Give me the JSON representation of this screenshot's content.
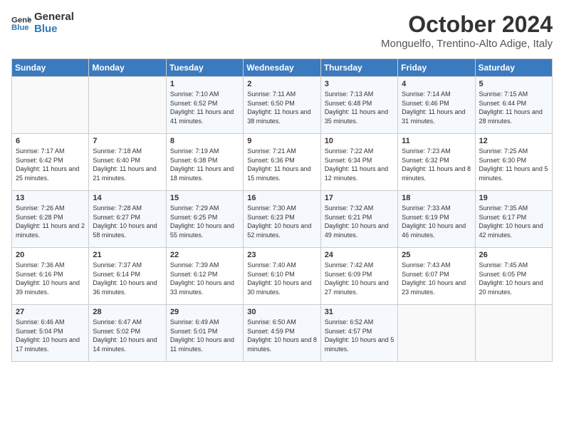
{
  "header": {
    "logo_line1": "General",
    "logo_line2": "Blue",
    "month": "October 2024",
    "location": "Monguelfo, Trentino-Alto Adige, Italy"
  },
  "weekdays": [
    "Sunday",
    "Monday",
    "Tuesday",
    "Wednesday",
    "Thursday",
    "Friday",
    "Saturday"
  ],
  "weeks": [
    [
      {
        "day": "",
        "sunrise": "",
        "sunset": "",
        "daylight": ""
      },
      {
        "day": "",
        "sunrise": "",
        "sunset": "",
        "daylight": ""
      },
      {
        "day": "1",
        "sunrise": "Sunrise: 7:10 AM",
        "sunset": "Sunset: 6:52 PM",
        "daylight": "Daylight: 11 hours and 41 minutes."
      },
      {
        "day": "2",
        "sunrise": "Sunrise: 7:11 AM",
        "sunset": "Sunset: 6:50 PM",
        "daylight": "Daylight: 11 hours and 38 minutes."
      },
      {
        "day": "3",
        "sunrise": "Sunrise: 7:13 AM",
        "sunset": "Sunset: 6:48 PM",
        "daylight": "Daylight: 11 hours and 35 minutes."
      },
      {
        "day": "4",
        "sunrise": "Sunrise: 7:14 AM",
        "sunset": "Sunset: 6:46 PM",
        "daylight": "Daylight: 11 hours and 31 minutes."
      },
      {
        "day": "5",
        "sunrise": "Sunrise: 7:15 AM",
        "sunset": "Sunset: 6:44 PM",
        "daylight": "Daylight: 11 hours and 28 minutes."
      }
    ],
    [
      {
        "day": "6",
        "sunrise": "Sunrise: 7:17 AM",
        "sunset": "Sunset: 6:42 PM",
        "daylight": "Daylight: 11 hours and 25 minutes."
      },
      {
        "day": "7",
        "sunrise": "Sunrise: 7:18 AM",
        "sunset": "Sunset: 6:40 PM",
        "daylight": "Daylight: 11 hours and 21 minutes."
      },
      {
        "day": "8",
        "sunrise": "Sunrise: 7:19 AM",
        "sunset": "Sunset: 6:38 PM",
        "daylight": "Daylight: 11 hours and 18 minutes."
      },
      {
        "day": "9",
        "sunrise": "Sunrise: 7:21 AM",
        "sunset": "Sunset: 6:36 PM",
        "daylight": "Daylight: 11 hours and 15 minutes."
      },
      {
        "day": "10",
        "sunrise": "Sunrise: 7:22 AM",
        "sunset": "Sunset: 6:34 PM",
        "daylight": "Daylight: 11 hours and 12 minutes."
      },
      {
        "day": "11",
        "sunrise": "Sunrise: 7:23 AM",
        "sunset": "Sunset: 6:32 PM",
        "daylight": "Daylight: 11 hours and 8 minutes."
      },
      {
        "day": "12",
        "sunrise": "Sunrise: 7:25 AM",
        "sunset": "Sunset: 6:30 PM",
        "daylight": "Daylight: 11 hours and 5 minutes."
      }
    ],
    [
      {
        "day": "13",
        "sunrise": "Sunrise: 7:26 AM",
        "sunset": "Sunset: 6:28 PM",
        "daylight": "Daylight: 11 hours and 2 minutes."
      },
      {
        "day": "14",
        "sunrise": "Sunrise: 7:28 AM",
        "sunset": "Sunset: 6:27 PM",
        "daylight": "Daylight: 10 hours and 58 minutes."
      },
      {
        "day": "15",
        "sunrise": "Sunrise: 7:29 AM",
        "sunset": "Sunset: 6:25 PM",
        "daylight": "Daylight: 10 hours and 55 minutes."
      },
      {
        "day": "16",
        "sunrise": "Sunrise: 7:30 AM",
        "sunset": "Sunset: 6:23 PM",
        "daylight": "Daylight: 10 hours and 52 minutes."
      },
      {
        "day": "17",
        "sunrise": "Sunrise: 7:32 AM",
        "sunset": "Sunset: 6:21 PM",
        "daylight": "Daylight: 10 hours and 49 minutes."
      },
      {
        "day": "18",
        "sunrise": "Sunrise: 7:33 AM",
        "sunset": "Sunset: 6:19 PM",
        "daylight": "Daylight: 10 hours and 46 minutes."
      },
      {
        "day": "19",
        "sunrise": "Sunrise: 7:35 AM",
        "sunset": "Sunset: 6:17 PM",
        "daylight": "Daylight: 10 hours and 42 minutes."
      }
    ],
    [
      {
        "day": "20",
        "sunrise": "Sunrise: 7:36 AM",
        "sunset": "Sunset: 6:16 PM",
        "daylight": "Daylight: 10 hours and 39 minutes."
      },
      {
        "day": "21",
        "sunrise": "Sunrise: 7:37 AM",
        "sunset": "Sunset: 6:14 PM",
        "daylight": "Daylight: 10 hours and 36 minutes."
      },
      {
        "day": "22",
        "sunrise": "Sunrise: 7:39 AM",
        "sunset": "Sunset: 6:12 PM",
        "daylight": "Daylight: 10 hours and 33 minutes."
      },
      {
        "day": "23",
        "sunrise": "Sunrise: 7:40 AM",
        "sunset": "Sunset: 6:10 PM",
        "daylight": "Daylight: 10 hours and 30 minutes."
      },
      {
        "day": "24",
        "sunrise": "Sunrise: 7:42 AM",
        "sunset": "Sunset: 6:09 PM",
        "daylight": "Daylight: 10 hours and 27 minutes."
      },
      {
        "day": "25",
        "sunrise": "Sunrise: 7:43 AM",
        "sunset": "Sunset: 6:07 PM",
        "daylight": "Daylight: 10 hours and 23 minutes."
      },
      {
        "day": "26",
        "sunrise": "Sunrise: 7:45 AM",
        "sunset": "Sunset: 6:05 PM",
        "daylight": "Daylight: 10 hours and 20 minutes."
      }
    ],
    [
      {
        "day": "27",
        "sunrise": "Sunrise: 6:46 AM",
        "sunset": "Sunset: 5:04 PM",
        "daylight": "Daylight: 10 hours and 17 minutes."
      },
      {
        "day": "28",
        "sunrise": "Sunrise: 6:47 AM",
        "sunset": "Sunset: 5:02 PM",
        "daylight": "Daylight: 10 hours and 14 minutes."
      },
      {
        "day": "29",
        "sunrise": "Sunrise: 6:49 AM",
        "sunset": "Sunset: 5:01 PM",
        "daylight": "Daylight: 10 hours and 11 minutes."
      },
      {
        "day": "30",
        "sunrise": "Sunrise: 6:50 AM",
        "sunset": "Sunset: 4:59 PM",
        "daylight": "Daylight: 10 hours and 8 minutes."
      },
      {
        "day": "31",
        "sunrise": "Sunrise: 6:52 AM",
        "sunset": "Sunset: 4:57 PM",
        "daylight": "Daylight: 10 hours and 5 minutes."
      },
      {
        "day": "",
        "sunrise": "",
        "sunset": "",
        "daylight": ""
      },
      {
        "day": "",
        "sunrise": "",
        "sunset": "",
        "daylight": ""
      }
    ]
  ]
}
